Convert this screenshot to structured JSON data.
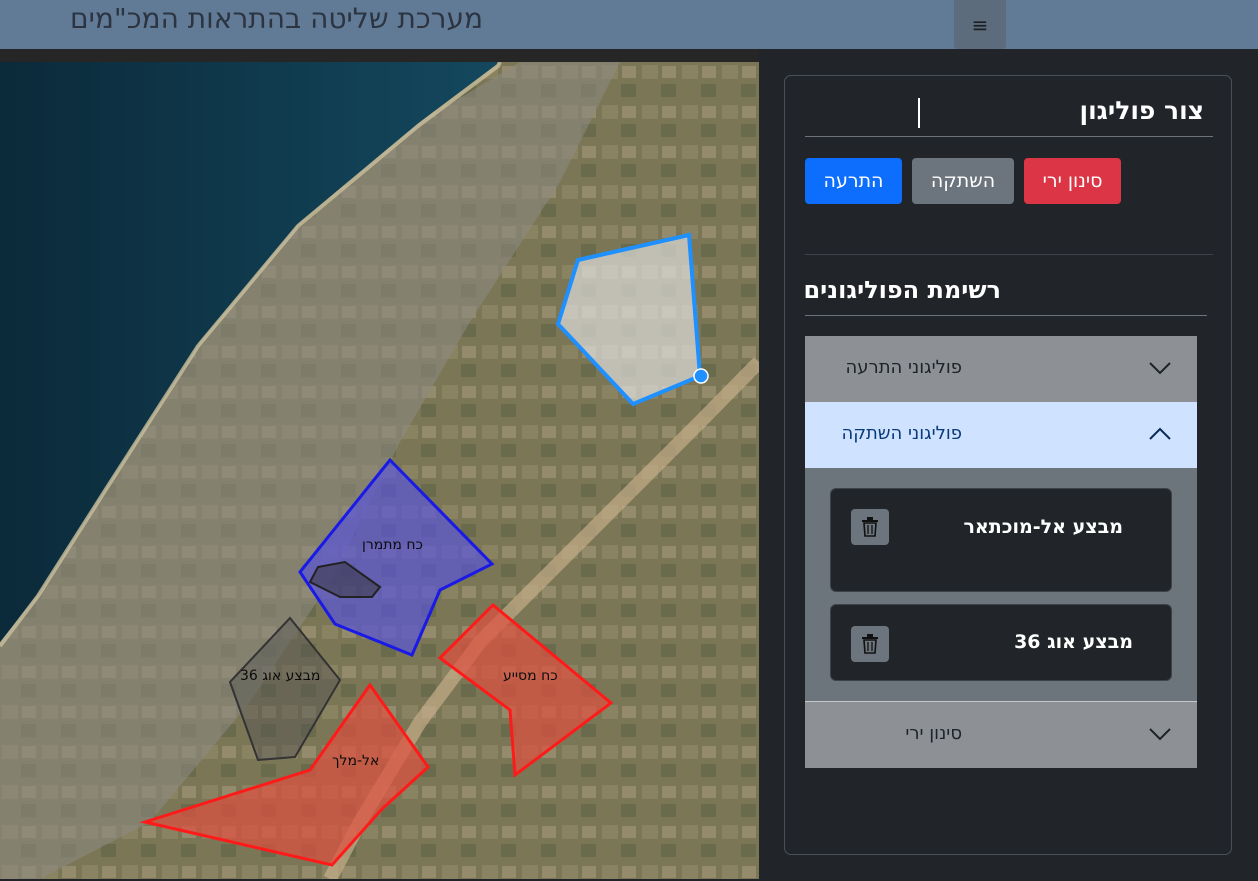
{
  "app": {
    "title": "מערכת שליטה בהתראות המכ\"מים"
  },
  "menu": {
    "icon": "hamburger-icon",
    "glyph": "≡"
  },
  "panel": {
    "draw_title": "צור פוליגון",
    "buttons": {
      "alert": "התרעה",
      "mute": "השתקה",
      "fire_filter": "סינון ירי"
    },
    "list_title": "רשימת הפוליגונים",
    "accordion": [
      {
        "label": "פוליגוני התרעה",
        "expanded": false
      },
      {
        "label": "פוליגוני השתקה",
        "expanded": true,
        "items": [
          {
            "name": "מבצע אל-מוכתאר"
          },
          {
            "name": "מבצע אוג 36"
          }
        ]
      },
      {
        "label": "סינון ירי",
        "expanded": false
      }
    ]
  },
  "map": {
    "labels": {
      "blue": "כח מתמרן",
      "gray": "מבצע אוג 36",
      "red_east": "כח מסייע",
      "red_south": "אל-מלך"
    }
  },
  "colors": {
    "alert": "#0d6efd",
    "mute": "#6c757d",
    "fire": "#dc3545",
    "topbar": "#617b96",
    "accordion_open": "#cfe2ff"
  }
}
